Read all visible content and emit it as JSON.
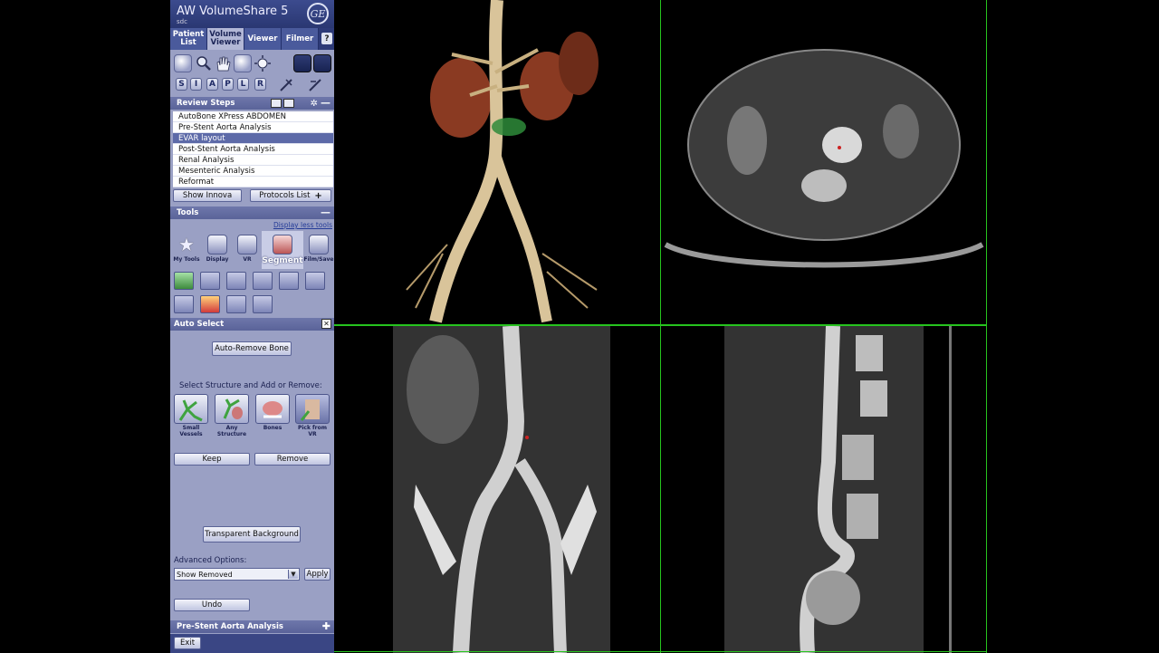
{
  "app": {
    "title": "AW VolumeShare 5",
    "subtitle": "sdc",
    "logo_text": "GE"
  },
  "tabs": [
    {
      "label": "Patient List"
    },
    {
      "label": "Volume Viewer"
    },
    {
      "label": "Viewer"
    },
    {
      "label": "Filmer"
    }
  ],
  "help_label": "?",
  "orient_letters": [
    "S",
    "I",
    "A",
    "P",
    "L",
    "R"
  ],
  "review": {
    "title": "Review Steps",
    "items": [
      "AutoBone XPress ABDOMEN",
      "Pre-Stent Aorta Analysis",
      "EVAR layout",
      "Post-Stent Aorta Analysis",
      "Renal Analysis",
      "Mesenteric Analysis",
      "Reformat"
    ],
    "show_innova": "Show Innova",
    "protocols_list": "Protocols List"
  },
  "tools": {
    "title": "Tools",
    "display_less": "Display less tools",
    "categories": [
      "My Tools",
      "Display",
      "VR",
      "Segment",
      "Film/Save"
    ]
  },
  "auto_select": {
    "title": "Auto Select",
    "close": "✕",
    "auto_remove_bone": "Auto-Remove Bone",
    "instruction": "Select Structure and Add or Remove:",
    "structures": [
      {
        "label": "Small Vessels"
      },
      {
        "label": "Any Structure"
      },
      {
        "label": "Bones"
      },
      {
        "label": "Pick from VR"
      }
    ],
    "keep": "Keep",
    "remove": "Remove",
    "transparent_bg": "Transparent Background",
    "advanced_label": "Advanced Options:",
    "dropdown_value": "Show Removed",
    "apply": "Apply",
    "undo": "Undo"
  },
  "footer": {
    "protocol": "Pre-Stent Aorta Analysis",
    "exit": "Exit"
  },
  "colors": {
    "panel": "#9aa0c4",
    "header": "#2a3772",
    "selected_row": "#5d6aa8",
    "viewport_border": "#26c41e"
  }
}
